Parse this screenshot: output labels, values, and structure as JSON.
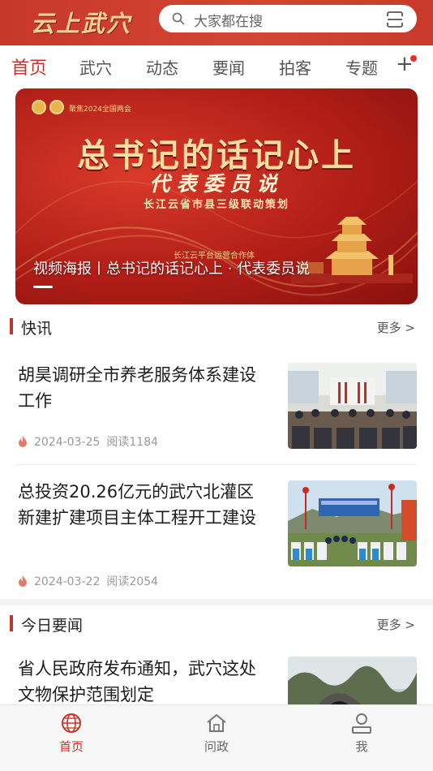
{
  "header": {
    "logo_text": "云上武穴",
    "search_placeholder": "大家都在搜",
    "accent_color": "#c8342a",
    "icons": [
      "search-icon",
      "scan-icon"
    ]
  },
  "tabs": [
    {
      "label": "首页",
      "active": true
    },
    {
      "label": "武穴",
      "active": false
    },
    {
      "label": "动态",
      "active": false
    },
    {
      "label": "要闻",
      "active": false
    },
    {
      "label": "拍客",
      "active": false
    },
    {
      "label": "专题",
      "active": false
    }
  ],
  "tabs_add_label": "+",
  "banner": {
    "kicker": "聚焦2024全国两会",
    "title": "总书记的话记心上",
    "subtitle": "代表委员说",
    "tagline": "长江云省市县三级联动策划",
    "credit": "长江云平台运营合作体",
    "caption": "视频海报丨总书记的话记心上 · 代表委员说"
  },
  "sections": [
    {
      "title": "快讯",
      "more": "更多 >",
      "items": [
        {
          "title": "胡昊调研全市养老服务体系建设工作",
          "date": "2024-03-25",
          "reads": "阅读1184"
        },
        {
          "title": "总投资20.26亿元的武穴北灌区新建扩建项目主体工程开工建设",
          "date": "2024-03-22",
          "reads": "阅读2054"
        }
      ]
    },
    {
      "title": "今日要闻",
      "more": "更多 >",
      "items": [
        {
          "title": "省人民政府发布通知，武穴这处文物保护范围划定"
        }
      ]
    }
  ],
  "bottom_nav": [
    {
      "label": "首页",
      "icon": "globe-icon",
      "active": true
    },
    {
      "label": "问政",
      "icon": "home-icon",
      "active": false
    },
    {
      "label": "我",
      "icon": "user-icon",
      "active": false
    }
  ]
}
